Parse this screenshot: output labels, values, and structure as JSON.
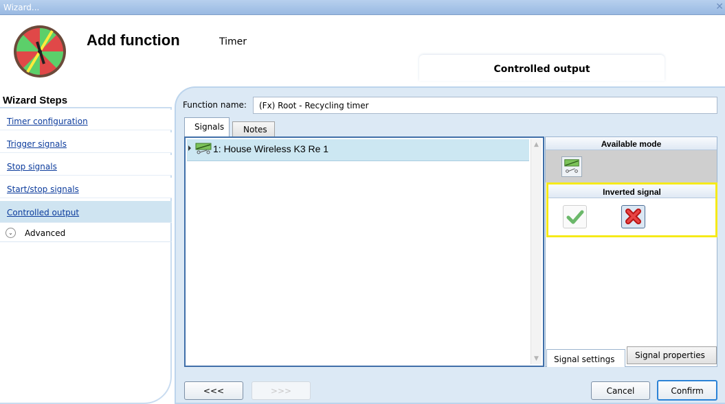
{
  "window": {
    "title": "Wizard...",
    "close_glyph": "✕"
  },
  "header": {
    "title": "Add function",
    "subtitle": "Timer",
    "step_title": "Controlled output",
    "logo": "timer-clock-logo"
  },
  "sidebar": {
    "heading": "Wizard Steps",
    "items": [
      {
        "label": "Timer configuration",
        "active": false
      },
      {
        "label": "Trigger signals",
        "active": false
      },
      {
        "label": "Stop signals",
        "active": false
      },
      {
        "label": "Start/stop signals",
        "active": false
      },
      {
        "label": "Controlled output",
        "active": true
      }
    ],
    "advanced": {
      "label": "Advanced",
      "icon": "chevron-down-icon"
    }
  },
  "form": {
    "function_name_label": "Function name:",
    "function_name_value": "(Fx) Root - Recycling timer"
  },
  "tabs": {
    "signals": "Signals",
    "notes": "Notes"
  },
  "signal_list": {
    "rows": [
      {
        "label": "1: House Wireless K3 Re 1",
        "icon": "relay-switch-icon"
      }
    ]
  },
  "settings_panel": {
    "available_mode_heading": "Available mode",
    "available_mode_icon": "relay-switch-icon",
    "inverted_signal_heading": "Inverted signal",
    "inverted_yes_icon": "checkmark-icon",
    "inverted_no_icon": "cross-icon",
    "inverted_selected": "no",
    "tab_signal_settings": "Signal settings",
    "tab_signal_properties": "Signal properties"
  },
  "footer": {
    "prev": "<<<",
    "next": ">>>",
    "cancel": "Cancel",
    "confirm": "Confirm"
  },
  "colors": {
    "accent": "#2a82d6",
    "highlight": "#f6ea18",
    "selection": "#cce7f2",
    "panel_bg": "#dce9f5"
  }
}
